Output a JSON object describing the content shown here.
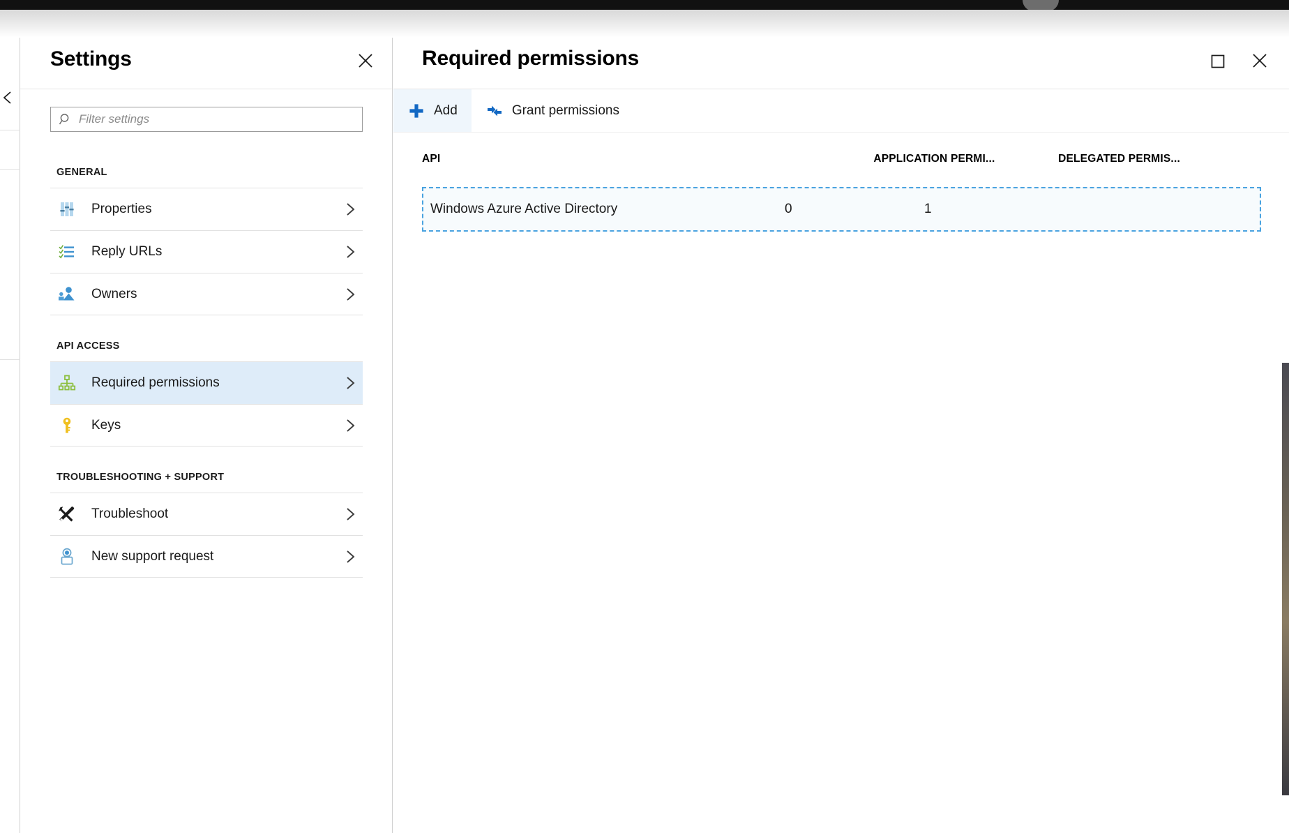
{
  "settings_blade": {
    "title": "Settings",
    "close_label": "Close",
    "filter": {
      "placeholder": "Filter settings",
      "value": "",
      "icon": "search-icon"
    },
    "sections": [
      {
        "heading": "GENERAL",
        "items": [
          {
            "label": "Properties",
            "icon": "sliders-icon",
            "selected": false
          },
          {
            "label": "Reply URLs",
            "icon": "checklist-icon",
            "selected": false
          },
          {
            "label": "Owners",
            "icon": "people-icon",
            "selected": false
          }
        ]
      },
      {
        "heading": "API ACCESS",
        "items": [
          {
            "label": "Required permissions",
            "icon": "hierarchy-icon",
            "selected": true
          },
          {
            "label": "Keys",
            "icon": "key-icon",
            "selected": false
          }
        ]
      },
      {
        "heading": "TROUBLESHOOTING + SUPPORT",
        "items": [
          {
            "label": "Troubleshoot",
            "icon": "tools-icon",
            "selected": false
          },
          {
            "label": "New support request",
            "icon": "support-icon",
            "selected": false
          }
        ]
      }
    ]
  },
  "permissions_blade": {
    "title": "Required permissions",
    "maximize_label": "Maximize",
    "close_label": "Close",
    "toolbar": [
      {
        "label": "Add",
        "icon": "plus-icon",
        "active": true
      },
      {
        "label": "Grant permissions",
        "icon": "grant-icon",
        "active": false
      }
    ],
    "table": {
      "columns": [
        "API",
        "APPLICATION PERMI...",
        "DELEGATED PERMIS..."
      ],
      "rows": [
        {
          "api": "Windows Azure Active Directory",
          "application_permissions": "0",
          "delegated_permissions": "1"
        }
      ]
    }
  },
  "colors": {
    "accent": "#0078d4",
    "selected_row_bg": "#deecf9",
    "focus_border": "#4aa3e0",
    "toolbar_active_bg": "#eff6fc"
  }
}
